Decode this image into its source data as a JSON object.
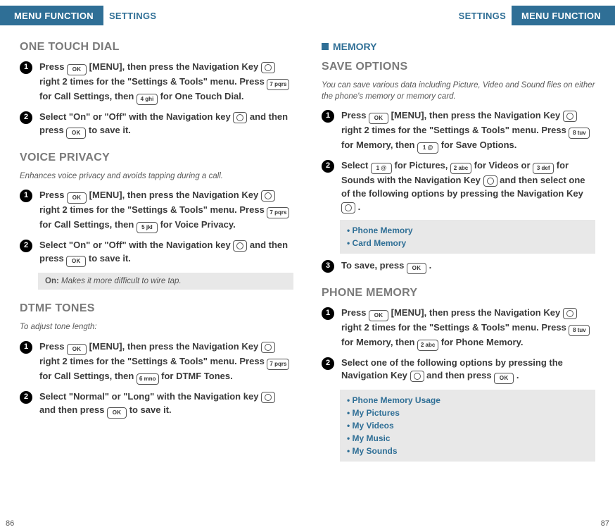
{
  "header": {
    "menu_function": "MENU FUNCTION",
    "settings": "SETTINGS"
  },
  "keys": {
    "ok": "OK",
    "d7": "7 pqrs",
    "d4": "4 ghi",
    "d5": "5 jkl",
    "d6": "6 mno",
    "d8": "8 tuv",
    "d1": "1  @",
    "d2": "2 abc",
    "d3": "3 def"
  },
  "left": {
    "one_touch": {
      "title": "ONE TOUCH DIAL",
      "s1a": "Press ",
      "s1b": " [MENU], then press the Navigation Key ",
      "s1c": " right 2 times for the \"Settings & Tools\" menu. Press ",
      "s1d": " for Call Settings, then ",
      "s1e": " for One Touch Dial.",
      "s2a": "Select \"On\" or \"Off\" with the Navigation key ",
      "s2b": " and then press ",
      "s2c": " to save it."
    },
    "voice_privacy": {
      "title": "VOICE PRIVACY",
      "intro": "Enhances voice privacy and avoids tapping during a call.",
      "s1a": "Press ",
      "s1b": " [MENU], then press the Navigation Key ",
      "s1c": " right 2 times for the \"Settings & Tools\" menu. Press ",
      "s1d": " for Call Settings, then ",
      "s1e": " for Voice Privacy.",
      "s2a": "Select \"On\" or \"Off\" with the Navigation key ",
      "s2b": " and then press ",
      "s2c": " to save it.",
      "note_lbl": "On:",
      "note_txt": " Makes it more difficult to wire tap."
    },
    "dtmf": {
      "title": "DTMF TONES",
      "intro": "To adjust tone length:",
      "s1a": "Press ",
      "s1b": " [MENU], then press the Navigation Key ",
      "s1c": " right 2 times for the \"Settings & Tools\" menu. Press ",
      "s1d": " for Call Settings, then ",
      "s1e": " for DTMF Tones.",
      "s2a": "Select \"Normal\" or \"Long\" with the Navigation key ",
      "s2b": " and then press ",
      "s2c": " to save it."
    },
    "pagenum": "86"
  },
  "right": {
    "memory_title": "MEMORY",
    "save_options": {
      "title": "SAVE OPTIONS",
      "intro": "You can save various data including Picture, Video and Sound files on either the phone's memory or memory card.",
      "s1a": "Press ",
      "s1b": " [MENU], then press the Navigation Key ",
      "s1c": " right 2 times for the \"Settings & Tools\" menu. Press ",
      "s1d": " for Memory, then ",
      "s1e": " for Save Options.",
      "s2a": "Select ",
      "s2b": " for Pictures, ",
      "s2c": " for Videos or ",
      "s2d": " for Sounds with the Navigation Key ",
      "s2e": " and then select one of the following options by pressing the Navigation Key ",
      "s2f": " .",
      "opt1": "Phone Memory",
      "opt2": "Card Memory",
      "s3a": "To save, press ",
      "s3b": " ."
    },
    "phone_memory": {
      "title": "PHONE MEMORY",
      "s1a": "Press ",
      "s1b": " [MENU], then press the Navigation Key ",
      "s1c": " right 2 times for the \"Settings & Tools\" menu. Press ",
      "s1d": " for Memory, then ",
      "s1e": " for Phone Memory.",
      "s2a": "Select one of the following options by pressing the Navigation Key ",
      "s2b": " and then press ",
      "s2c": " .",
      "opt1": "Phone Memory Usage",
      "opt2": "My Pictures",
      "opt3": "My Videos",
      "opt4": "My Music",
      "opt5": "My Sounds"
    },
    "pagenum": "87"
  }
}
